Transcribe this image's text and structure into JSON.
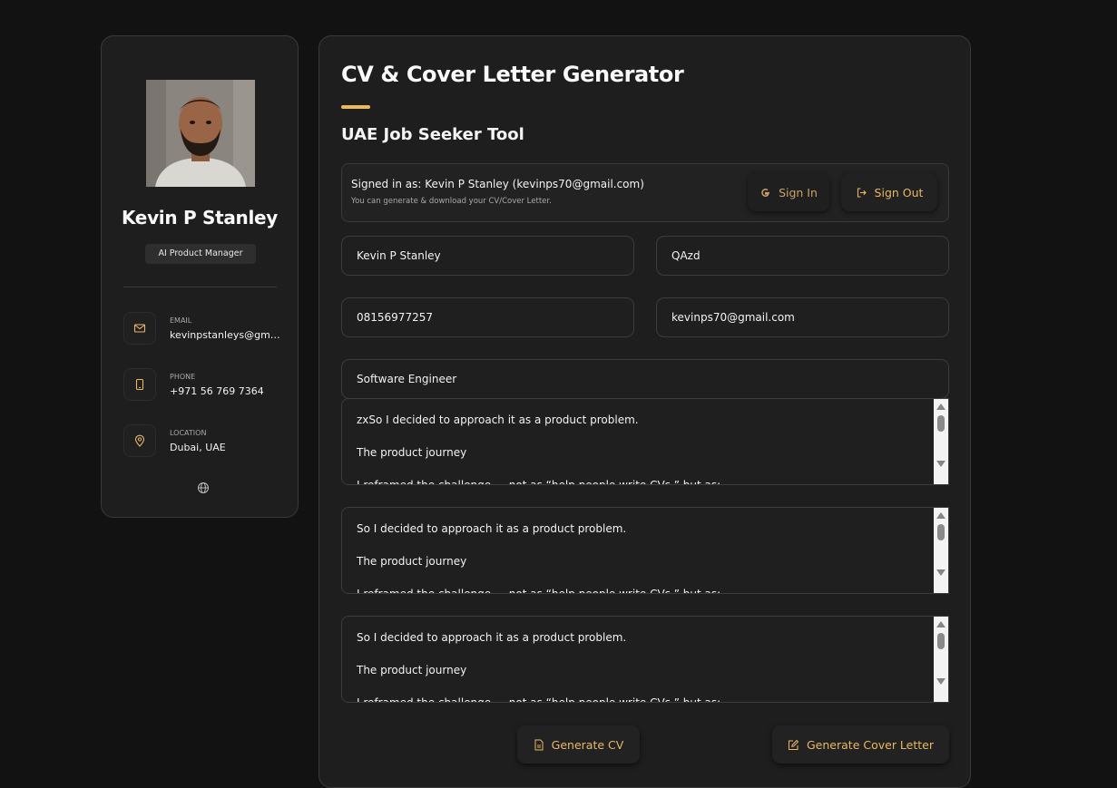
{
  "colors": {
    "accent": "#e8b95f",
    "background": "#121212",
    "panel": "#1e1e1e",
    "border": "#3a3a3a"
  },
  "profile": {
    "name": "Kevin P Stanley",
    "role": "AI Product Manager",
    "contacts": [
      {
        "icon": "mail-icon",
        "label": "EMAIL",
        "value": "kevinpstanleys@gmail.com"
      },
      {
        "icon": "phone-icon",
        "label": "PHONE",
        "value": "+971 56 769 7364"
      },
      {
        "icon": "map-pin-icon",
        "label": "LOCATION",
        "value": "Dubai, UAE"
      }
    ],
    "footer_icon": "globe-icon"
  },
  "main": {
    "title": "CV & Cover Letter Generator",
    "subtitle": "UAE Job Seeker Tool",
    "auth": {
      "signed_in_text": "Signed in as: Kevin P Stanley (kevinps70@gmail.com)",
      "note": "You can generate & download your CV/Cover Letter.",
      "sign_in_label": "Sign In",
      "sign_out_label": "Sign Out"
    },
    "fields": {
      "name": "Kevin P Stanley",
      "location": "QAzd",
      "phone": "08156977257",
      "email": "kevinps70@gmail.com",
      "job_title": "Software Engineer"
    },
    "textareas": [
      "zxSo I decided to approach it as a product problem.\n\nThe product journey\n\nI reframed the challenge — not as “help people write CVs,” but as:",
      "So I decided to approach it as a product problem.\n\nThe product journey\n\nI reframed the challenge — not as “help people write CVs,” but as:",
      "So I decided to approach it as a product problem.\n\nThe product journey\n\nI reframed the challenge — not as “help people write CVs,” but as:"
    ],
    "actions": {
      "generate_cv_label": "Generate CV",
      "generate_cover_letter_label": "Generate Cover Letter"
    }
  }
}
